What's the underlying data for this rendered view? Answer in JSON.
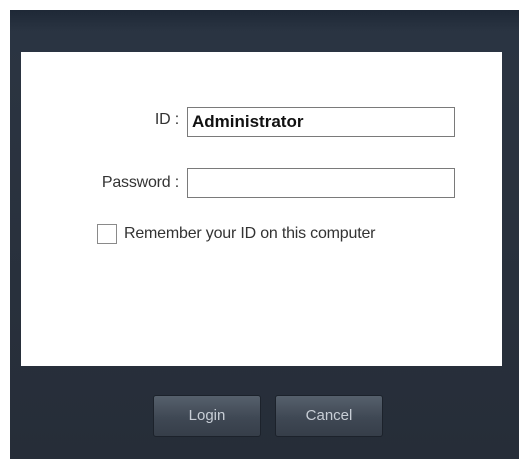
{
  "login": {
    "id_label": "ID :",
    "id_value": "Administrator",
    "password_label": "Password :",
    "password_value": "",
    "remember_label": "Remember your ID on this computer",
    "remember_checked": false
  },
  "buttons": {
    "login_label": "Login",
    "cancel_label": "Cancel"
  },
  "colors": {
    "frame": "#2b3441",
    "button": "#444c57",
    "button_text": "#c8ced6"
  }
}
